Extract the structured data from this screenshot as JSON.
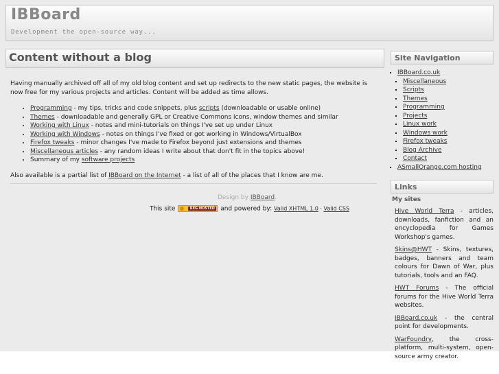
{
  "header": {
    "title": "IBBoard",
    "tagline": "Development the open-source way..."
  },
  "content": {
    "title": "Content without a blog",
    "intro": "Having manually archived off all of my old blog content and set up redirects to the new static pages, the website is now free for my various projects and articles. Content will be added as time allows.",
    "items": [
      {
        "link": "Programming",
        "text": " - my tips, tricks and code snippets, plus ",
        "link2": "scripts",
        "text2": " (downloadable or usable online)"
      },
      {
        "link": "Themes",
        "text": " - downloadable and generally GPL or Creative Commons icons, window themes and similar"
      },
      {
        "link": "Working with Linux",
        "text": " - notes and mini-tutorials on things I've set up under Linux"
      },
      {
        "link": "Working with Windows",
        "text": " - notes on things I've fixed or got working in Windows/VirtualBox"
      },
      {
        "link": "Firefox tweaks",
        "text": " - minor changes I've made to Firefox beyond just extensions and themes"
      },
      {
        "link": "Miscellaneous articles",
        "text": " - any random ideas I write about that don't fit in the topics above!"
      },
      {
        "pre": "Summary of my ",
        "link": "software projects",
        "text": ""
      }
    ],
    "also_pre": "Also available is a partial list of ",
    "also_link": "IBBoard on the Internet",
    "also_post": " - a list of all of the places that I know are me."
  },
  "footer": {
    "design_pre": "Design by ",
    "design_link": "IBBoard",
    "design_post": ".",
    "site_pre": "This site ",
    "badge_text": "REG HOSTED",
    "powered": " and powered by: ",
    "xhtml": "Valid XHTML 1.0",
    "sep": " · ",
    "css": "Valid CSS"
  },
  "sidebar": {
    "nav_title": "Site Navigation",
    "nav_root": "IBBoard.co.uk",
    "nav_items": [
      "Miscellaneous",
      "Scripts",
      "Themes",
      "Programming",
      "Projects",
      "Linux work",
      "Windows work",
      "Firefox tweaks",
      "Blog Archive",
      "Contact"
    ],
    "nav_hosting": "ASmallOrange.com hosting",
    "links_title": "Links",
    "my_sites": "My sites",
    "sites": [
      {
        "link": "Hive World Terra",
        "text": " - articles, downloads, fanfiction and an encyclopedia for Games Workshop's games."
      },
      {
        "link": "Skins@HWT",
        "text": " - Skins, textures, badges, banners and team colours for Dawn of War, plus tutorials, tools and an FAQ."
      },
      {
        "link": "HWT Forums",
        "text": " - The official forums for the Hive World Terra websites."
      },
      {
        "link": "IBBoard.co.uk",
        "text": " - the central point for developments."
      },
      {
        "link": "WarFoundry",
        "text": ", the cross-platform, multi-system, open-source army creator."
      }
    ]
  }
}
